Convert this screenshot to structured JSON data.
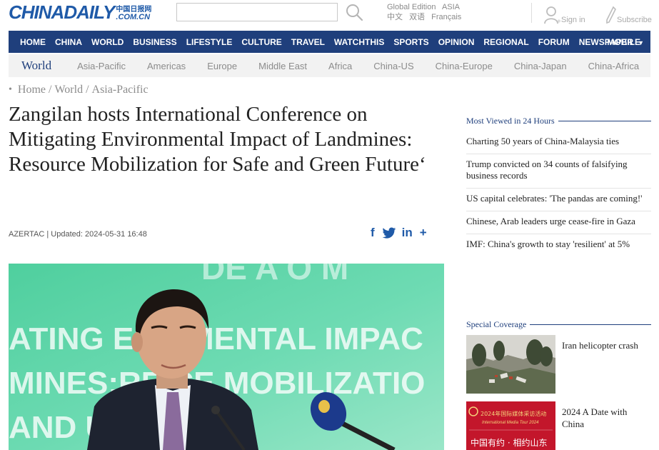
{
  "brand": {
    "logo_main": "CHINADAILY",
    "logo_cn": "中国日报网",
    "logo_com": ".COM.CN"
  },
  "header": {
    "search_placeholder": "",
    "edition_line1": [
      "Global Edition",
      "ASIA"
    ],
    "edition_line2": [
      "中文",
      "双语",
      "Français"
    ],
    "signin_label": "Sign in",
    "subscribe_label": "Subscribe"
  },
  "main_nav": {
    "items": [
      "HOME",
      "CHINA",
      "WORLD",
      "BUSINESS",
      "LIFESTYLE",
      "CULTURE",
      "TRAVEL",
      "WATCHTHIS",
      "SPORTS",
      "OPINION",
      "REGIONAL",
      "FORUM",
      "NEWSPAPER"
    ],
    "newspaper_caret": "▼",
    "mobile_label": "MOBILE"
  },
  "sub_nav": {
    "active": "World",
    "items": [
      "Asia-Pacific",
      "Americas",
      "Europe",
      "Middle East",
      "Africa",
      "China-US",
      "China-Europe",
      "China-Japan",
      "China-Africa"
    ]
  },
  "breadcrumb": {
    "bullet": "•",
    "items": [
      "Home",
      "World",
      "Asia-Pacific"
    ],
    "separator": "/"
  },
  "article": {
    "headline": "Zangilan hosts International Conference on Mitigating Environmental Impact of Landmines: Resource Mobilization for Safe and Green Future‘",
    "meta": "AZERTAC | Updated: 2024-05-31 16:48",
    "share": {
      "facebook": "f",
      "linkedin": "in",
      "more": "+"
    },
    "photo_banner_text": [
      "ATING EN   NMENTAL IMPAC",
      "MINES:RE    CE MOBILIZATIO",
      "AND        URE\""
    ]
  },
  "sidebar": {
    "most_viewed_title": "Most Viewed in 24 Hours",
    "most_viewed": [
      "Charting 50 years of China-Malaysia ties",
      "Trump convicted on 34 counts of falsifying business records",
      "US capital celebrates: 'The pandas are coming!'",
      "Chinese, Arab leaders urge cease-fire in Gaza",
      "IMF: China's growth to stay 'resilient' at 5%"
    ],
    "special_title": "Special Coverage",
    "special": [
      {
        "label": "Iran helicopter crash"
      },
      {
        "label": "2024 A Date with China",
        "thumb_text_top": "2024年国际媒体采访活动",
        "thumb_text_mid": "International Media Tour 2024",
        "thumb_text_bottom": "中国有约 · 相约山东"
      }
    ]
  },
  "colors": {
    "brand_blue": "#1f5aa8",
    "nav_navy": "#1f3f7c",
    "subnav_bg": "#f2f2f2",
    "photo_green": "#5fd3a7"
  }
}
